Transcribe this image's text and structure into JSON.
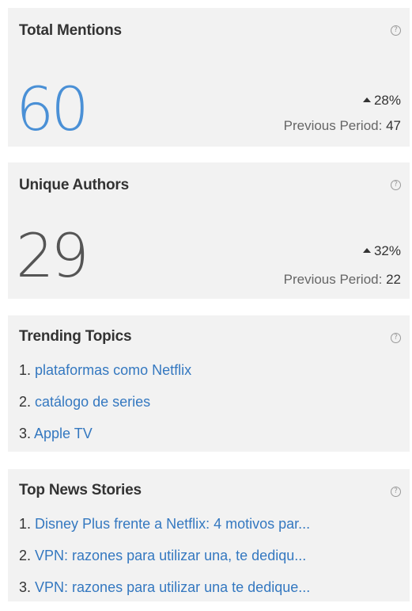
{
  "total_mentions": {
    "title": "Total Mentions",
    "help": "?",
    "value": "60",
    "change": "28%",
    "previous_label": "Previous Period:",
    "previous_value": "47"
  },
  "unique_authors": {
    "title": "Unique Authors",
    "help": "?",
    "value": "29",
    "change": "32%",
    "previous_label": "Previous Period:",
    "previous_value": "22"
  },
  "trending_topics": {
    "title": "Trending Topics",
    "help": "?",
    "items": [
      {
        "num": "1.",
        "label": "plataformas como Netflix"
      },
      {
        "num": "2.",
        "label": "catálogo de series"
      },
      {
        "num": "3.",
        "label": "Apple TV"
      }
    ]
  },
  "top_news": {
    "title": "Top News Stories",
    "help": "?",
    "items": [
      {
        "num": "1.",
        "label": "Disney Plus frente a Netflix: 4 motivos par..."
      },
      {
        "num": "2.",
        "label": "VPN: razones para utilizar una, te dediqu..."
      },
      {
        "num": "3.",
        "label": "VPN: razones para utilizar una te dedique..."
      }
    ]
  },
  "colors": {
    "panel_bg": "#f2f2f2",
    "accent_blue": "#4a90d6",
    "link_blue": "#3478c0",
    "text_dark": "#333333"
  }
}
